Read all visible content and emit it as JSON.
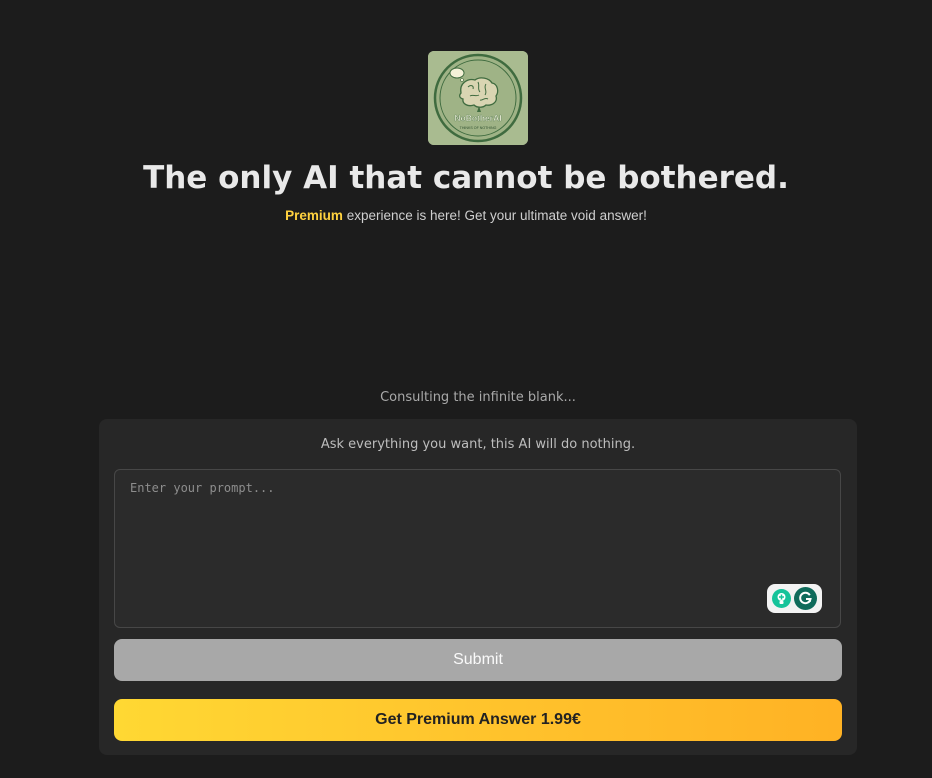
{
  "logo": {
    "name": "NoBotherAI",
    "tagline": "THINKS OF NOTHING"
  },
  "header": {
    "title": "The only AI that cannot be bothered.",
    "subtitle_highlight": "Premium",
    "subtitle_rest": " experience is here! Get your ultimate void answer!"
  },
  "status_text": "Consulting the infinite blank...",
  "card": {
    "hint": "Ask everything you want, this AI will do nothing.",
    "prompt_placeholder": "Enter your prompt...",
    "prompt_value": "",
    "submit_label": "Submit",
    "premium_label": "Get Premium Answer 1.99€"
  },
  "icons": {
    "logo": "brain-icon",
    "assistant": "lightbulb-icon",
    "grammarly": "grammarly-icon"
  },
  "colors": {
    "background": "#1c1c1c",
    "card": "#272727",
    "accent": "#ffd23f",
    "submit": "#a8a8a8"
  }
}
